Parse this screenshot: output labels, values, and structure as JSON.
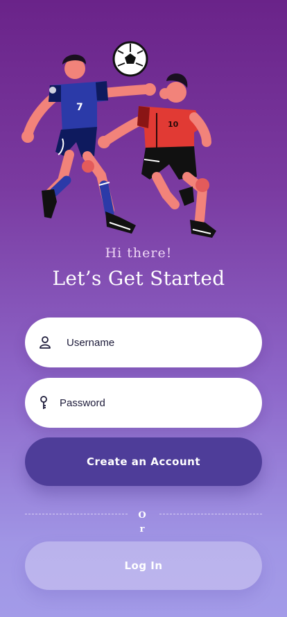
{
  "header": {
    "greeting": "Hi there!",
    "title": "Let’s Get Started"
  },
  "form": {
    "username": {
      "placeholder": "Username",
      "value": "",
      "icon": "user-icon"
    },
    "password": {
      "placeholder": "Password",
      "value": "",
      "icon": "key-icon"
    }
  },
  "actions": {
    "create_account_label": "Create an Account",
    "divider_text": "Or",
    "login_label": "Log In"
  },
  "colors": {
    "background_top": "#6a2389",
    "background_bottom": "#a39be8",
    "primary_button": "#4e3d99",
    "text_dark": "#1d1b3a"
  }
}
